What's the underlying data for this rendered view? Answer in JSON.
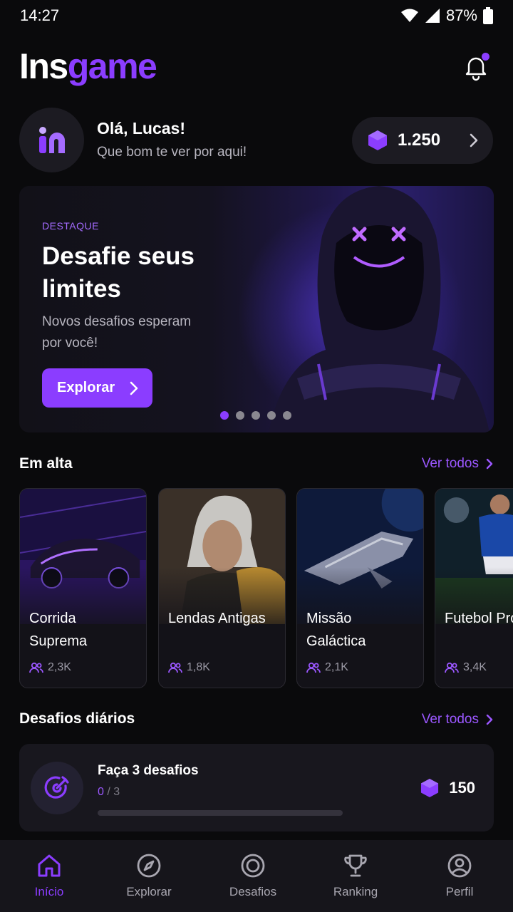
{
  "status_bar": {
    "time": "14:27",
    "battery": "87%"
  },
  "header": {
    "logo_part1": "Ins",
    "logo_part2": "game"
  },
  "greeting": {
    "title": "Olá, Lucas!",
    "subtitle": "Que bom te ver por aqui!"
  },
  "balance": {
    "value": "1.250"
  },
  "hero": {
    "tag": "DESTAQUE",
    "title": "Desafie seus limites",
    "subtitle": "Novos desafios esperam por você!",
    "button": "Explorar",
    "slides_total": 5,
    "slide_active": 1
  },
  "trending": {
    "title": "Em alta",
    "see_all": "Ver todos",
    "games": [
      {
        "name": "Corrida Suprema",
        "players": "2,3K"
      },
      {
        "name": "Lendas Antigas",
        "players": "1,8K"
      },
      {
        "name": "Missão Galáctica",
        "players": "2,1K"
      },
      {
        "name": "Futebol Pro",
        "players": "3,4K"
      }
    ]
  },
  "daily": {
    "title": "Desafios diários",
    "see_all": "Ver todos",
    "challenge": {
      "title": "Faça 3 desafios",
      "done": "0",
      "total": "/ 3",
      "progress": 0,
      "reward": "150"
    }
  },
  "nav": [
    {
      "label": "Início",
      "icon": "home-icon",
      "active": true
    },
    {
      "label": "Explorar",
      "icon": "compass-icon",
      "active": false
    },
    {
      "label": "Desafios",
      "icon": "target-icon",
      "active": false
    },
    {
      "label": "Ranking",
      "icon": "trophy-icon",
      "active": false
    },
    {
      "label": "Perfil",
      "icon": "user-icon",
      "active": false
    }
  ],
  "colors": {
    "accent": "#8b3dff",
    "background": "#0a0a0c",
    "surface": "#1c1b22"
  }
}
